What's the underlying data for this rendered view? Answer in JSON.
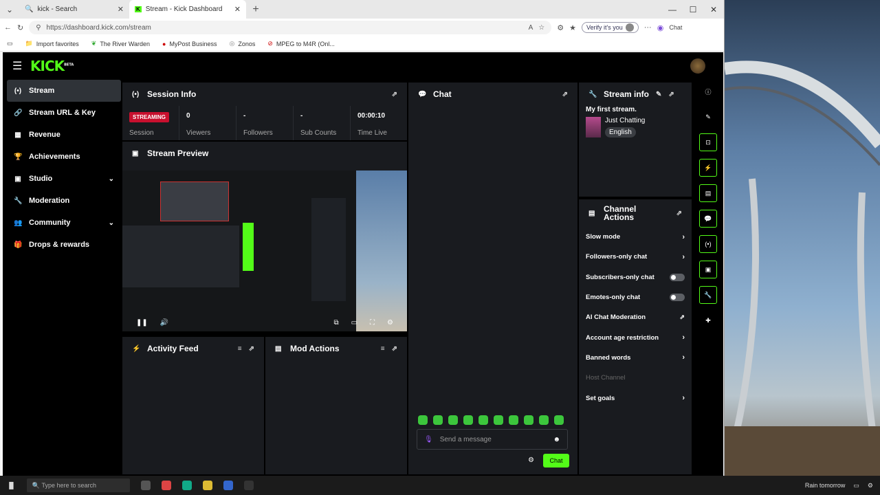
{
  "browser": {
    "tabs": [
      {
        "label": "kick - Search",
        "icon": "search-icon"
      },
      {
        "label": "Stream - Kick Dashboard",
        "icon": "kick-icon"
      }
    ],
    "url": "https://dashboard.kick.com/stream",
    "verify_label": "Verify it's you",
    "chat_label": "Chat",
    "bookmarks": [
      "Import favorites",
      "The River Warden",
      "MyPost Business",
      "Zonos",
      "MPEG to M4R (Onl..."
    ]
  },
  "app": {
    "logo": "KICK",
    "logo_badge": "BETA",
    "accent": "#53fc18",
    "nav": [
      {
        "label": "Stream",
        "icon": "stream-icon",
        "active": true
      },
      {
        "label": "Stream URL & Key",
        "icon": "link-icon"
      },
      {
        "label": "Revenue",
        "icon": "revenue-icon"
      },
      {
        "label": "Achievements",
        "icon": "trophy-icon"
      },
      {
        "label": "Studio",
        "icon": "studio-icon",
        "expand": true
      },
      {
        "label": "Moderation",
        "icon": "wrench-icon"
      },
      {
        "label": "Community",
        "icon": "community-icon",
        "expand": true
      },
      {
        "label": "Drops & rewards",
        "icon": "gift-icon"
      }
    ],
    "session": {
      "title": "Session Info",
      "status_badge": "STREAMING",
      "status_label": "Session",
      "stats": [
        {
          "value": "0",
          "label": "Viewers"
        },
        {
          "value": "-",
          "label": "Followers"
        },
        {
          "value": "-",
          "label": "Sub Counts"
        },
        {
          "value": "00:00:10",
          "label": "Time Live"
        }
      ]
    },
    "preview": {
      "title": "Stream Preview"
    },
    "activity": {
      "title": "Activity Feed"
    },
    "mod": {
      "title": "Mod Actions"
    },
    "chat": {
      "title": "Chat",
      "placeholder": "Send a message",
      "send_label": "Chat"
    },
    "stream_info": {
      "title": "Stream info",
      "stream_title": "My first stream.",
      "category": "Just Chatting",
      "language": "English"
    },
    "channel_actions": {
      "title": "Channel Actions",
      "items": [
        {
          "label": "Slow mode",
          "control": "chevron"
        },
        {
          "label": "Followers-only chat",
          "control": "chevron"
        },
        {
          "label": "Subscribers-only chat",
          "control": "toggle"
        },
        {
          "label": "Emotes-only chat",
          "control": "toggle"
        },
        {
          "label": "AI Chat Moderation",
          "control": "external"
        },
        {
          "label": "Account age restriction",
          "control": "chevron"
        },
        {
          "label": "Banned words",
          "control": "chevron"
        },
        {
          "label": "Host Channel",
          "control": "none",
          "disabled": true
        },
        {
          "label": "Set goals",
          "control": "chevron"
        }
      ]
    }
  },
  "taskbar": {
    "search_placeholder": "Type here to search",
    "weather": "Rain tomorrow"
  }
}
